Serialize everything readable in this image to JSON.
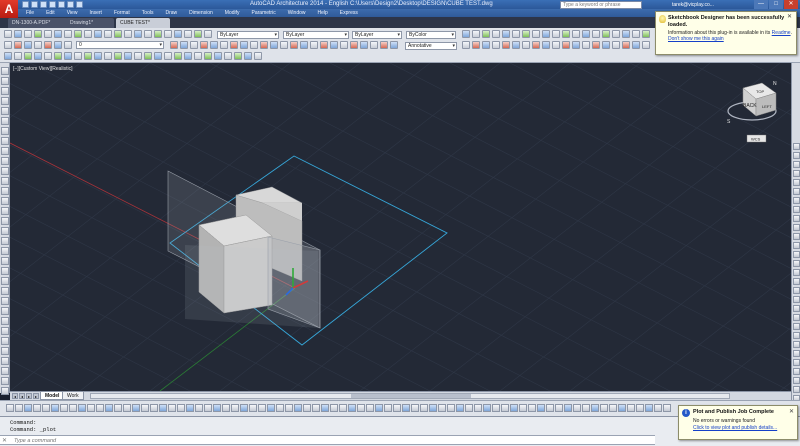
{
  "app": {
    "logo_letter": "A",
    "title": "AutoCAD Architecture 2014 - English    C:\\Users\\Design2\\Desktop\\DESIGN\\CUBE TEST.dwg",
    "search_placeholder": "Type a keyword or phrase",
    "user": "tarek@vicplay.co..."
  },
  "window_buttons": [
    "—",
    "□",
    "✕"
  ],
  "menu": [
    "File",
    "Edit",
    "View",
    "Insert",
    "Format",
    "Tools",
    "Draw",
    "Dimension",
    "Modify",
    "Parametric",
    "Window",
    "Help",
    "Express"
  ],
  "tabs": [
    {
      "label": "DN-1300-A.PDF*"
    },
    {
      "label": "Drawing1*"
    },
    {
      "label": "CUBE TEST*"
    }
  ],
  "toolbar": {
    "layer_value": "0",
    "color_value": "ByLayer",
    "linetype_value": "ByLayer",
    "lineweight_value": "ByLayer",
    "plotstyle_value": "ByColor",
    "annotation_scale": "Annotative"
  },
  "viewport": {
    "label": "[−][Custom View][Realistic]",
    "viewcube_face": "BACK",
    "viewcube_top": "TOP",
    "viewcube_right": "LEFT",
    "compass_s": "S",
    "compass_n": "N",
    "wcs_label": "WCS"
  },
  "notification": {
    "title": "Sketchbook Designer has been successfully loaded.",
    "message_prefix": "Information about this plug-in is available in its ",
    "message_link": "Readme",
    "message_suffix": ".",
    "dismiss_link": "Don't show me this again"
  },
  "layout_tabs": [
    "Model",
    "Work"
  ],
  "command": {
    "history": [
      "Command:",
      "Command:  _plot"
    ],
    "prompt_placeholder": "Type a command",
    "prompt_icon": "✕"
  },
  "plot_notification": {
    "title": "Plot and Publish Job Complete",
    "message": "No errors or warnings found",
    "link": "Click to view plot and publish details..."
  },
  "colors": {
    "viewport_bg": "#232936",
    "grid": "#2f3747",
    "selection_cyan": "#36a6d8",
    "axis_red": "#b0343a",
    "axis_green": "#2f8f3a",
    "cube_face": "#c8c8c8"
  }
}
